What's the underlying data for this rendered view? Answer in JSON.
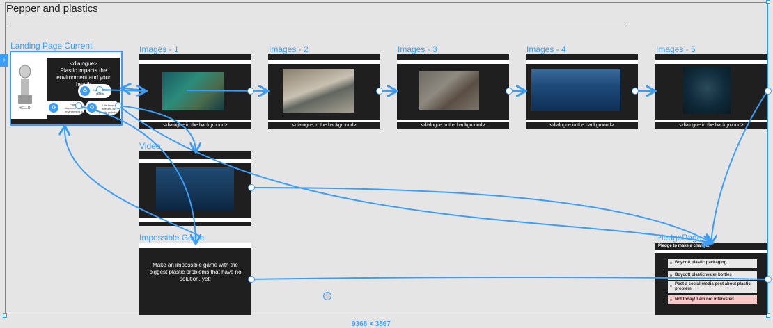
{
  "section": {
    "title": "Pepper and plastics",
    "dimensions": "9368 × 3867"
  },
  "frames": {
    "landing": {
      "label": "Landing Page Current",
      "dialogue": "<dialogue>",
      "headline": "Plastic impacts the environment and your health",
      "hello": "HELLO!",
      "option1": "Eat contains plastic",
      "option2": "Plastic disposed in the environment is dangerous",
      "option3": "Life forms affected by plastic pollution"
    },
    "images1": {
      "label": "Images - 1",
      "caption": "<dialogue in the background>"
    },
    "images2": {
      "label": "Images - 2",
      "caption": "<dialogue in the background>"
    },
    "images3": {
      "label": "Images - 3",
      "caption": "<dialogue in the background>"
    },
    "images4": {
      "label": "Images - 4",
      "caption": "<dialogue in the background>"
    },
    "images5": {
      "label": "Images - 5",
      "caption": "<dialogue in the background>"
    },
    "video": {
      "label": "Video"
    },
    "game": {
      "label": "Impossible Game",
      "text": "Make an impossible game with the biggest plastic problems that have no solution, yet!"
    },
    "pledge": {
      "label": "PledgePage",
      "title": "Pledge to make a change!",
      "items": [
        "Boycott plastic packaging",
        "Boycott plastic water bottles",
        "Post a social media post about plastic problem",
        "Not today! I am not interested"
      ]
    }
  },
  "colors": {
    "accent": "#3a9df7",
    "canvas": "#e5e5e5",
    "frame_dark": "#1f1f1f"
  }
}
